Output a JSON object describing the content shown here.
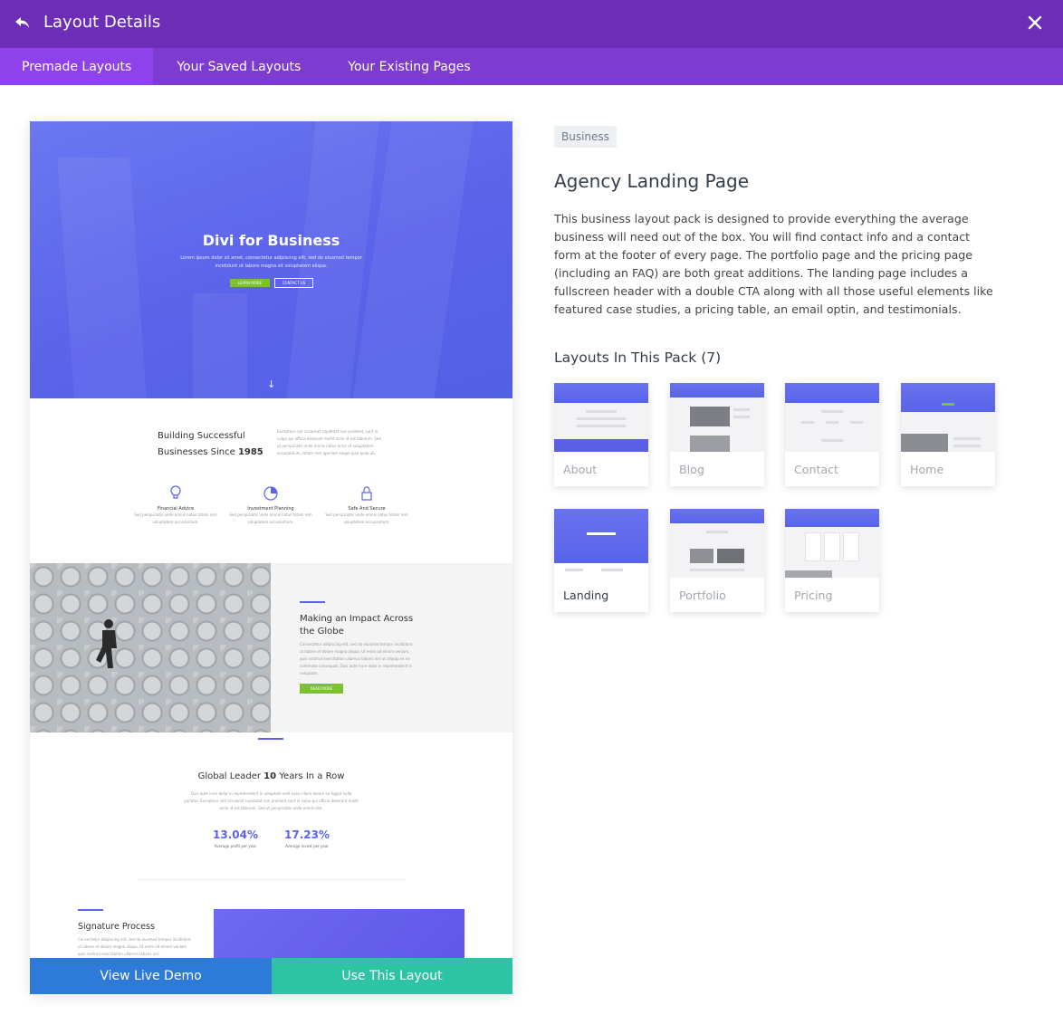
{
  "header": {
    "title": "Layout Details",
    "back_icon": "undo-arrow-icon",
    "close_icon": "close-icon"
  },
  "tabs": [
    {
      "label": "Premade Layouts",
      "active": true
    },
    {
      "label": "Your Saved Layouts",
      "active": false
    },
    {
      "label": "Your Existing Pages",
      "active": false
    }
  ],
  "preview": {
    "hero_title": "Divi for Business",
    "hero_sub": "Lorem ipsum dolor sit amet, consectetur adipiscing elit, sed do eiusmod tempor incididunt ut labore magna sit voluptatem aliqua.",
    "hero_btn_primary": "LEARN MORE",
    "hero_btn_secondary": "CONTACT US",
    "arrow": "↓",
    "section2_heading_line1": "Building Successful",
    "section2_heading_line2_pre": "Businesses Since ",
    "section2_heading_year": "1985",
    "section2_text": "Excepteur sint occaecat cupidatat non proident, sunt in culpa qui officia deserunt mollit anim id est laborum. Sed ut perspiciatis unde omnis natus error sit voluptatem accusantium, totam rem aperiam eaque ipsa quae ab.",
    "features": [
      {
        "title": "Financial Advice",
        "text": "Sed perspiciatis unde omnis natus totam rem voluptatem accusantium.",
        "icon": "lightbulb-icon"
      },
      {
        "title": "Investment Planning",
        "text": "Sed perspiciatis unde omnis natus totam rem voluptatem accusantium.",
        "icon": "pie-chart-icon"
      },
      {
        "title": "Safe And Secure",
        "text": "Sed perspiciatis unde omnis natus totam rem voluptatem accusantium.",
        "icon": "lock-icon"
      }
    ],
    "impact_title_line1": "Making an Impact Across",
    "impact_title_line2": "the Globe",
    "impact_text": "Consectetur adipiscing elit, sed do eiusmod tempor incididunt ut labore et dolore magna aliqua. Ut enim ad minim veniam, quis nostrud exercitation ullamco laboris nisi ut aliquip ex ea commodo consequat. Duis aute irure dolor in reprehenderit in voluptate.",
    "impact_btn": "READ MORE",
    "leader_title_pre": "Global Leader ",
    "leader_title_bold": "10",
    "leader_title_post": " Years In a Row",
    "leader_text": "Duis aute irure dolor in reprehenderit in voluptate velit esse cillum dolore eu fugiat nulla pariatur. Excepteur sint occaecat cupidatat non proident sunt in culpa qui officia deserunt mollit anim id est laborum. Sed ut perspiciatis unde omnis iste.",
    "stats": [
      {
        "value": "13.04%",
        "label": "Average profit per year"
      },
      {
        "value": "17.23%",
        "label": "Average invest per year"
      }
    ],
    "signature_title": "Signature Process",
    "signature_text": "Consectetur adipiscing elit, sed do eiusmod tempor incididunt ut labore et dolore magna aliqua. Ut enim ad minim veniam quis nostrud exercitation ullamco laboris nisi.",
    "btn_demo": "View Live Demo",
    "btn_use": "Use This Layout"
  },
  "info": {
    "category": "Business",
    "title": "Agency Landing Page",
    "description": "This business layout pack is designed to provide everything the average business will need out of the box. You will find contact info and a contact form at the footer of every page. The portfolio page and the pricing page (including an FAQ) are both great additions. The landing page includes a fullscreen header with a double CTA along with all those useful elements like featured case studies, a pricing table, an email optin, and testimonials.",
    "pack_title": "Layouts In This Pack (7)"
  },
  "pack_layouts": [
    {
      "label": "About",
      "selected": false
    },
    {
      "label": "Blog",
      "selected": false
    },
    {
      "label": "Contact",
      "selected": false
    },
    {
      "label": "Home",
      "selected": false
    },
    {
      "label": "Landing",
      "selected": true
    },
    {
      "label": "Portfolio",
      "selected": false
    },
    {
      "label": "Pricing",
      "selected": false
    }
  ],
  "colors": {
    "header": "#6c2eb9",
    "tabs": "#7e3bd0",
    "tab_active": "#8f42ec",
    "hero_blue": "#5b63ea",
    "accent_green": "#7cc22f",
    "demo_button": "#2d7ad8",
    "use_button": "#2cc4a4"
  }
}
